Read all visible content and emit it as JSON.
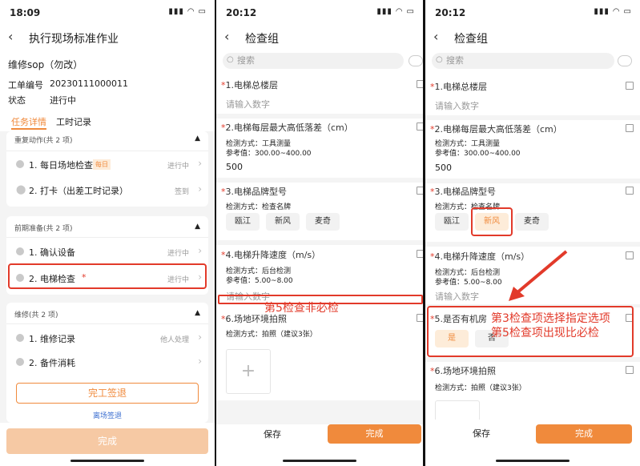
{
  "p1": {
    "time": "18:09",
    "title": "执行现场标准作业",
    "sop_name": "维修sop（勿改）",
    "ticket_label": "工单编号",
    "ticket_value": "20230111000011",
    "status_label": "状态",
    "status_value": "进行中",
    "tabs": [
      "任务详情",
      "工时记录"
    ],
    "group1": {
      "title": "重复动作(共 2 项)",
      "items": [
        {
          "label": "1. 每日场地检查",
          "badge": "每日",
          "state": "进行中"
        },
        {
          "label": "2. 打卡（出差工时记录）",
          "state": "签到"
        }
      ]
    },
    "group2": {
      "title": "前期准备(共 2 项)",
      "items": [
        {
          "label": "1. 确认设备",
          "state": "进行中"
        },
        {
          "label": "2. 电梯检查",
          "star": "*",
          "state": "进行中"
        }
      ]
    },
    "group3": {
      "title": "维修(共 2 项)",
      "items": [
        {
          "label": "1. 维修记录",
          "state": "他人处理"
        },
        {
          "label": "2. 备件消耗",
          "state": ""
        }
      ]
    },
    "finish_sign_btn": "完工签退",
    "leave_sign": "离场签退",
    "complete_btn": "完成"
  },
  "p2": {
    "time": "20:12",
    "title": "检查组",
    "search_placeholder": "搜索",
    "q1": {
      "star": "*",
      "title": "1.电梯总楼层",
      "placeholder": "请输入数字"
    },
    "q2": {
      "star": "*",
      "title": "2.电梯每层最大高低落差（cm）",
      "method": "检测方式：工具测量",
      "ref": "参考值：300.00~400.00",
      "value": "500"
    },
    "q3": {
      "star": "*",
      "title": "3.电梯品牌型号",
      "method": "检测方式：检查名牌",
      "options": [
        "瓯江",
        "新风",
        "麦奇"
      ]
    },
    "q4": {
      "star": "*",
      "title": "4.电梯升降速度（m/s）",
      "method": "检测方式：后台检测",
      "ref": "参考值：5.00~8.00",
      "placeholder": "请输入数字"
    },
    "q6": {
      "star": "*",
      "title": "6.场地环境拍照",
      "method": "检测方式：拍照（建议3张）"
    },
    "annotation": "第5检查非必检",
    "save_btn": "保存",
    "complete_btn": "完成"
  },
  "p3": {
    "time": "20:12",
    "title": "检查组",
    "search_placeholder": "搜索",
    "q1": {
      "star": "*",
      "title": "1.电梯总楼层",
      "placeholder": "请输入数字"
    },
    "q2": {
      "star": "*",
      "title": "2.电梯每层最大高低落差（cm）",
      "method": "检测方式：工具测量",
      "ref": "参考值：300.00~400.00",
      "value": "500"
    },
    "q3": {
      "star": "*",
      "title": "3.电梯品牌型号",
      "method": "检测方式：检查名牌",
      "options": [
        "瓯江",
        "新风",
        "麦奇"
      ]
    },
    "q4": {
      "star": "*",
      "title": "4.电梯升降速度（m/s）",
      "method": "检测方式：后台检测",
      "ref": "参考值：5.00~8.00",
      "placeholder": "请输入数字"
    },
    "q5": {
      "star": "*",
      "title": "5.是否有机房",
      "options": [
        "是",
        "否"
      ]
    },
    "q6": {
      "star": "*",
      "title": "6.场地环境拍照",
      "method": "检测方式：拍照（建议3张）"
    },
    "annotation_line1": "第3检查项选择指定选项",
    "annotation_line2": "第5检查项出现比必检",
    "save_btn": "保存",
    "complete_btn": "完成"
  },
  "colors": {
    "accent": "#f08a3c",
    "annotation": "#e23a2a"
  }
}
